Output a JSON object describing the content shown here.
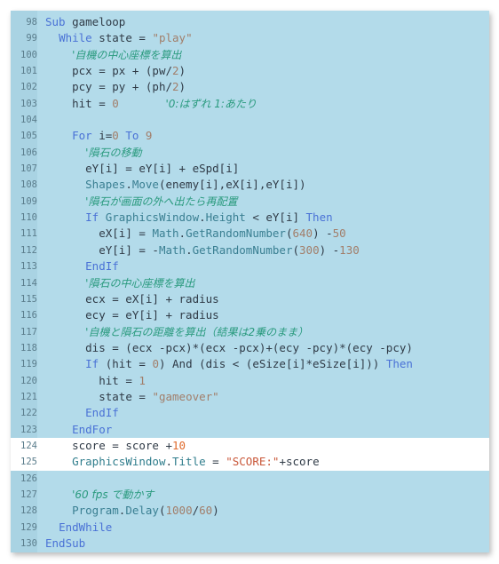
{
  "editor": {
    "highlighted_lines": [
      124,
      125
    ],
    "colors": {
      "background": "#b3dbea",
      "gutter": "#a9d3e3",
      "highlight": "#ffffff",
      "keyword": "#4a72d6",
      "string": "#a27e6a",
      "comment": "#2a9a7e",
      "object": "#3a7f92"
    },
    "lines": [
      {
        "n": "98",
        "indent": 0,
        "tokens": [
          [
            "kw",
            "Sub"
          ],
          [
            "",
            ""
          ],
          [
            "",
            " gameloop"
          ]
        ]
      },
      {
        "n": "99",
        "indent": 2,
        "tokens": [
          [
            "kw",
            "While"
          ],
          [
            "",
            " state = "
          ],
          [
            "str",
            "\"play\""
          ]
        ]
      },
      {
        "n": "100",
        "indent": 4,
        "tokens": [
          [
            "cmt",
            "'自機の中心座標を算出"
          ]
        ]
      },
      {
        "n": "101",
        "indent": 4,
        "tokens": [
          [
            "",
            "pcx = px + (pw/"
          ],
          [
            "num",
            "2"
          ],
          [
            "",
            ")"
          ]
        ]
      },
      {
        "n": "102",
        "indent": 4,
        "tokens": [
          [
            "",
            "pcy = py + (ph/"
          ],
          [
            "num",
            "2"
          ],
          [
            "",
            ")"
          ]
        ]
      },
      {
        "n": "103",
        "indent": 4,
        "tokens": [
          [
            "",
            "hit = "
          ],
          [
            "num",
            "0"
          ],
          [
            "",
            "       "
          ],
          [
            "cmt",
            "'0:はずれ 1:あたり"
          ]
        ]
      },
      {
        "n": "104",
        "indent": 0,
        "tokens": []
      },
      {
        "n": "105",
        "indent": 4,
        "tokens": [
          [
            "kw",
            "For"
          ],
          [
            "",
            " i="
          ],
          [
            "num",
            "0"
          ],
          [
            "",
            " "
          ],
          [
            "kw",
            "To"
          ],
          [
            "",
            " "
          ],
          [
            "num",
            "9"
          ]
        ]
      },
      {
        "n": "106",
        "indent": 6,
        "tokens": [
          [
            "cmt",
            "'隕石の移動"
          ]
        ]
      },
      {
        "n": "107",
        "indent": 6,
        "tokens": [
          [
            "",
            "eY[i] = eY[i] + eSpd[i]"
          ]
        ]
      },
      {
        "n": "108",
        "indent": 6,
        "tokens": [
          [
            "obj",
            "Shapes"
          ],
          [
            "",
            "."
          ],
          [
            "obj",
            "Move"
          ],
          [
            "",
            "(enemy[i],eX[i],eY[i])"
          ]
        ]
      },
      {
        "n": "109",
        "indent": 6,
        "tokens": [
          [
            "cmt",
            "'隕石が画面の外へ出たら再配置"
          ]
        ]
      },
      {
        "n": "110",
        "indent": 6,
        "tokens": [
          [
            "kw",
            "If"
          ],
          [
            "",
            " "
          ],
          [
            "obj",
            "GraphicsWindow"
          ],
          [
            "",
            "."
          ],
          [
            "obj",
            "Height"
          ],
          [
            "",
            " < eY[i] "
          ],
          [
            "kw",
            "Then"
          ]
        ]
      },
      {
        "n": "111",
        "indent": 8,
        "tokens": [
          [
            "",
            "eX[i] = "
          ],
          [
            "obj",
            "Math"
          ],
          [
            "",
            "."
          ],
          [
            "obj",
            "GetRandomNumber"
          ],
          [
            "",
            "("
          ],
          [
            "num",
            "640"
          ],
          [
            "",
            ") -"
          ],
          [
            "num",
            "50"
          ]
        ]
      },
      {
        "n": "112",
        "indent": 8,
        "tokens": [
          [
            "",
            "eY[i] = -"
          ],
          [
            "obj",
            "Math"
          ],
          [
            "",
            "."
          ],
          [
            "obj",
            "GetRandomNumber"
          ],
          [
            "",
            "("
          ],
          [
            "num",
            "300"
          ],
          [
            "",
            ") -"
          ],
          [
            "num",
            "130"
          ]
        ]
      },
      {
        "n": "113",
        "indent": 6,
        "tokens": [
          [
            "kw",
            "EndIf"
          ]
        ]
      },
      {
        "n": "114",
        "indent": 6,
        "tokens": [
          [
            "cmt",
            "'隕石の中心座標を算出"
          ]
        ]
      },
      {
        "n": "115",
        "indent": 6,
        "tokens": [
          [
            "",
            "ecx = eX[i] + radius"
          ]
        ]
      },
      {
        "n": "116",
        "indent": 6,
        "tokens": [
          [
            "",
            "ecy = eY[i] + radius"
          ]
        ]
      },
      {
        "n": "117",
        "indent": 6,
        "tokens": [
          [
            "cmt",
            "'自機と隕石の距離を算出（結果は2乗のまま）"
          ]
        ]
      },
      {
        "n": "118",
        "indent": 6,
        "tokens": [
          [
            "",
            "dis = (ecx -pcx)*(ecx -pcx)+(ecy -pcy)*(ecy -pcy)"
          ]
        ]
      },
      {
        "n": "119",
        "indent": 6,
        "tokens": [
          [
            "kw",
            "If"
          ],
          [
            "",
            " (hit = "
          ],
          [
            "num",
            "0"
          ],
          [
            "",
            ") And (dis < (eSize[i]*eSize[i])) "
          ],
          [
            "kw",
            "Then"
          ]
        ]
      },
      {
        "n": "120",
        "indent": 8,
        "tokens": [
          [
            "",
            "hit = "
          ],
          [
            "num",
            "1"
          ]
        ]
      },
      {
        "n": "121",
        "indent": 8,
        "tokens": [
          [
            "",
            "state = "
          ],
          [
            "str",
            "\"gameover\""
          ]
        ]
      },
      {
        "n": "122",
        "indent": 6,
        "tokens": [
          [
            "kw",
            "EndIf"
          ]
        ]
      },
      {
        "n": "123",
        "indent": 4,
        "tokens": [
          [
            "kw",
            "EndFor"
          ]
        ]
      },
      {
        "n": "124",
        "indent": 4,
        "tokens": [
          [
            "",
            "score = score +"
          ],
          [
            "num",
            "10"
          ]
        ]
      },
      {
        "n": "125",
        "indent": 4,
        "tokens": [
          [
            "obj",
            "GraphicsWindow"
          ],
          [
            "",
            "."
          ],
          [
            "obj",
            "Title"
          ],
          [
            "",
            " = "
          ],
          [
            "str",
            "\"SCORE:\""
          ],
          [
            "",
            "+score"
          ]
        ]
      },
      {
        "n": "126",
        "indent": 0,
        "tokens": []
      },
      {
        "n": "127",
        "indent": 4,
        "tokens": [
          [
            "cmt",
            "'60 fps で動かす"
          ]
        ]
      },
      {
        "n": "128",
        "indent": 4,
        "tokens": [
          [
            "obj",
            "Program"
          ],
          [
            "",
            "."
          ],
          [
            "obj",
            "Delay"
          ],
          [
            "",
            "("
          ],
          [
            "num",
            "1000"
          ],
          [
            "",
            "/"
          ],
          [
            "num",
            "60"
          ],
          [
            "",
            ")"
          ]
        ]
      },
      {
        "n": "129",
        "indent": 2,
        "tokens": [
          [
            "kw",
            "EndWhile"
          ]
        ]
      },
      {
        "n": "130",
        "indent": 0,
        "tokens": [
          [
            "kw",
            "EndSub"
          ]
        ]
      }
    ]
  }
}
